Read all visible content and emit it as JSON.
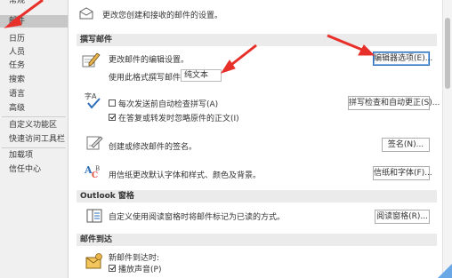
{
  "sidebar": {
    "items": [
      {
        "label": "常规"
      },
      {
        "label": "邮件"
      },
      {
        "label": "日历"
      },
      {
        "label": "人员"
      },
      {
        "label": "任务"
      },
      {
        "label": "搜索"
      },
      {
        "label": "语言"
      },
      {
        "label": "高级"
      },
      {
        "label": "自定义功能区"
      },
      {
        "label": "快速访问工具栏"
      },
      {
        "label": "加载项"
      },
      {
        "label": "信任中心"
      }
    ],
    "active": "邮件"
  },
  "header": {
    "description": "更改您创建和接收的邮件的设置。"
  },
  "compose": {
    "section_title": "撰写邮件",
    "edit_settings_text": "更改邮件的编辑设置。",
    "editor_options_button": "编辑器选项(E)...",
    "format_label": "使用此格式撰写邮件(C):",
    "format_value": "纯文本"
  },
  "spelling": {
    "check_before_send": "每次发送前自动检查拼写(A)",
    "check_before_send_checked": false,
    "ignore_original": "在答复或转发时忽略原件的正文(I)",
    "ignore_original_checked": true,
    "spelling_button": "拼写检查和自动更正(S)..."
  },
  "signature": {
    "text": "创建或修改邮件的签名。",
    "button": "签名(N)..."
  },
  "stationery": {
    "text": "用信纸更改默认字体和样式、颜色及背景。",
    "button": "信纸和字体(F)..."
  },
  "outlook_panes": {
    "section_title": "Outlook 窗格",
    "text": "自定义使用阅读窗格时将邮件标记为已读的方式。",
    "button": "阅读窗格(R)..."
  },
  "message_arrival": {
    "section_title": "邮件到达",
    "text": "新邮件到达时:",
    "play_sound": "播放声音(P)",
    "play_sound_checked": true
  },
  "colors": {
    "annotation_arrow": "#e8302a",
    "accent": "#2b6cb8"
  }
}
